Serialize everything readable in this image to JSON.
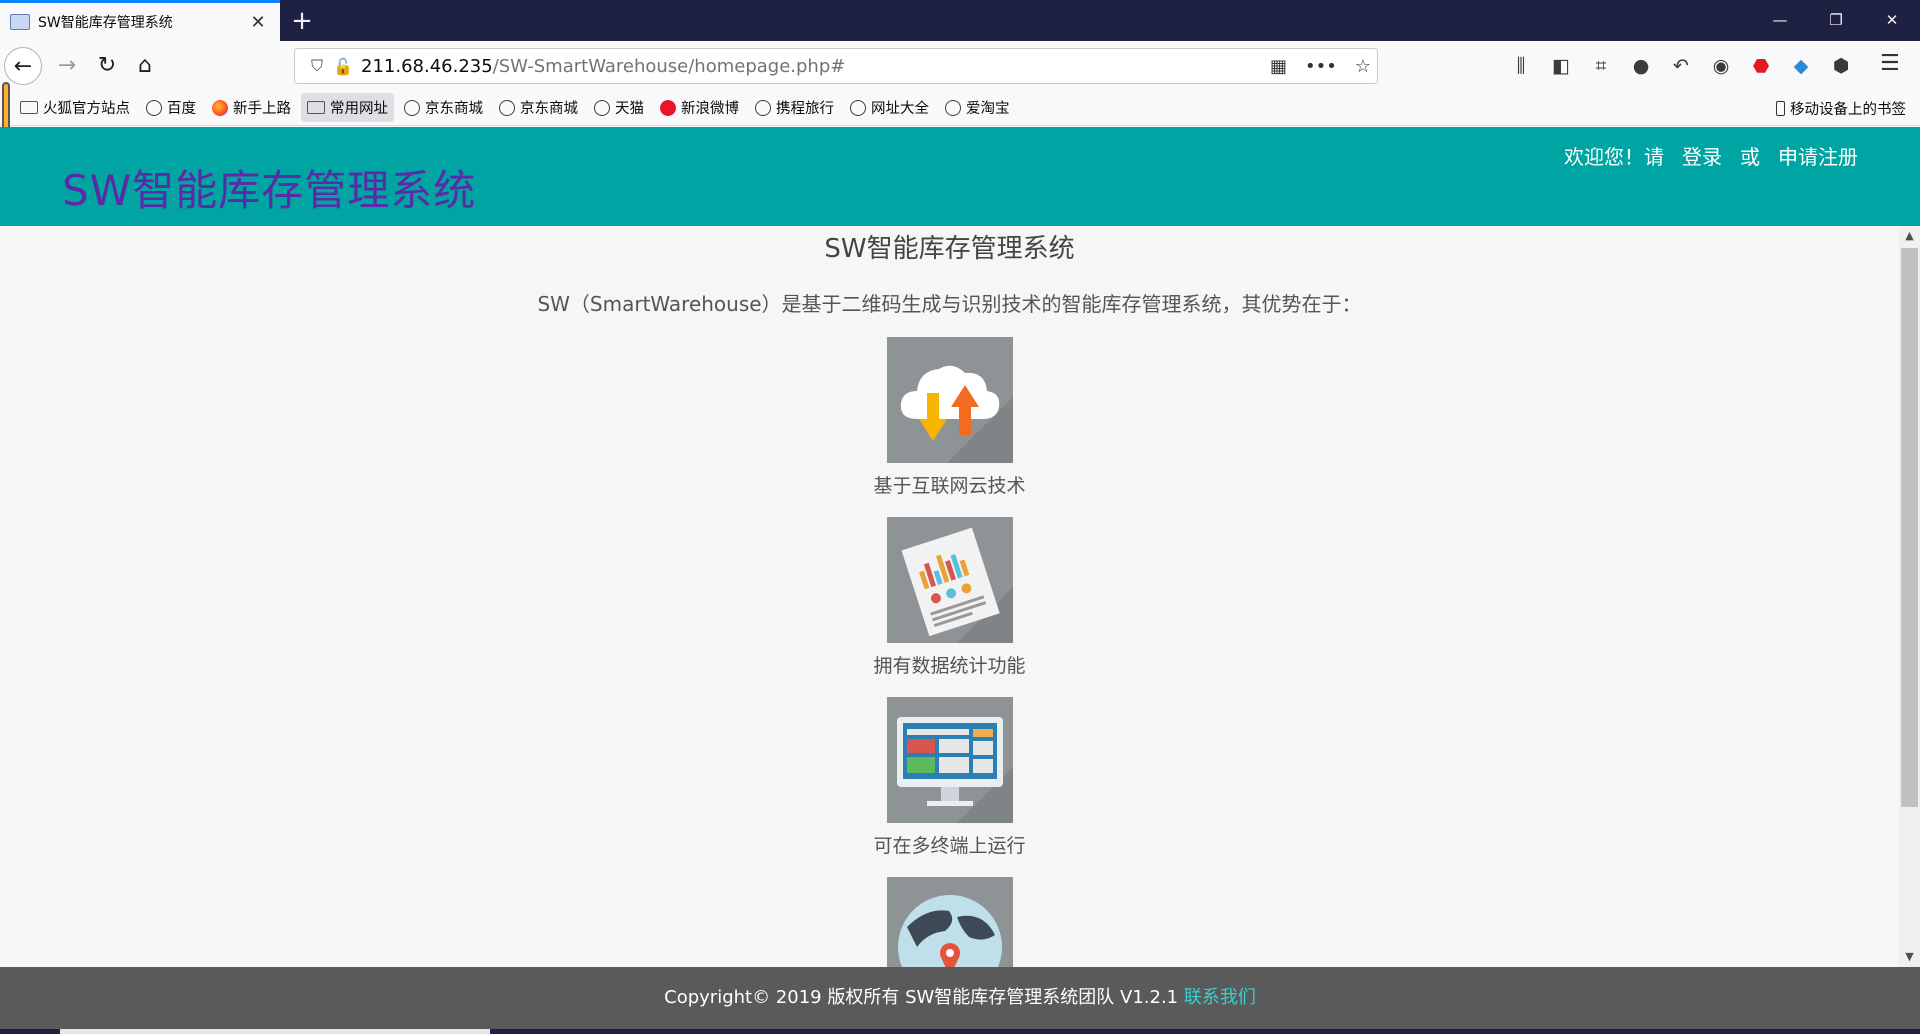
{
  "browser": {
    "tab_title": "SW智能库存管理系统",
    "tab_close": "✕",
    "new_tab": "+",
    "window_controls": {
      "minimize": "—",
      "restore": "❐",
      "close": "✕"
    },
    "url_host": "211.68.46.235",
    "url_path": "/SW-SmartWarehouse/homepage.php#",
    "bookmarks": [
      {
        "label": "火狐官方站点",
        "icon": "folder-icon"
      },
      {
        "label": "百度",
        "icon": "globe-icon"
      },
      {
        "label": "新手上路",
        "icon": "firefox-icon"
      },
      {
        "label": "常用网址",
        "icon": "folder-icon"
      },
      {
        "label": "京东商城",
        "icon": "globe-icon"
      },
      {
        "label": "京东商城",
        "icon": "globe-icon"
      },
      {
        "label": "天猫",
        "icon": "globe-icon"
      },
      {
        "label": "新浪微博",
        "icon": "weibo-icon"
      },
      {
        "label": "携程旅行",
        "icon": "globe-icon"
      },
      {
        "label": "网址大全",
        "icon": "globe-icon"
      },
      {
        "label": "爱淘宝",
        "icon": "globe-icon"
      }
    ],
    "mobile_bookmarks": "移动设备上的书签"
  },
  "header": {
    "site_title": "SW智能库存管理系统",
    "welcome": "欢迎您！请",
    "login": "登录",
    "or": "或",
    "register": "申请注册"
  },
  "main": {
    "title": "SW智能库存管理系统",
    "intro": "SW（SmartWarehouse）是基于二维码生成与识别技术的智能库存管理系统，其优势在于：",
    "features": [
      {
        "label": "基于互联网云技术",
        "icon": "cloud-transfer-icon"
      },
      {
        "label": "拥有数据统计功能",
        "icon": "report-chart-icon"
      },
      {
        "label": "可在多终端上运行",
        "icon": "monitor-icon"
      },
      {
        "label": "",
        "icon": "globe-location-icon"
      }
    ]
  },
  "footer": {
    "copyright": "Copyright© 2019 版权所有 SW智能库存管理系统团队 V1.2.1 ",
    "contact": "联系我们"
  },
  "colors": {
    "header_bg": "#00a5a3",
    "title": "#5b2aa6",
    "footer_bg": "#5a5a5a",
    "footer_link": "#33d1cf"
  }
}
